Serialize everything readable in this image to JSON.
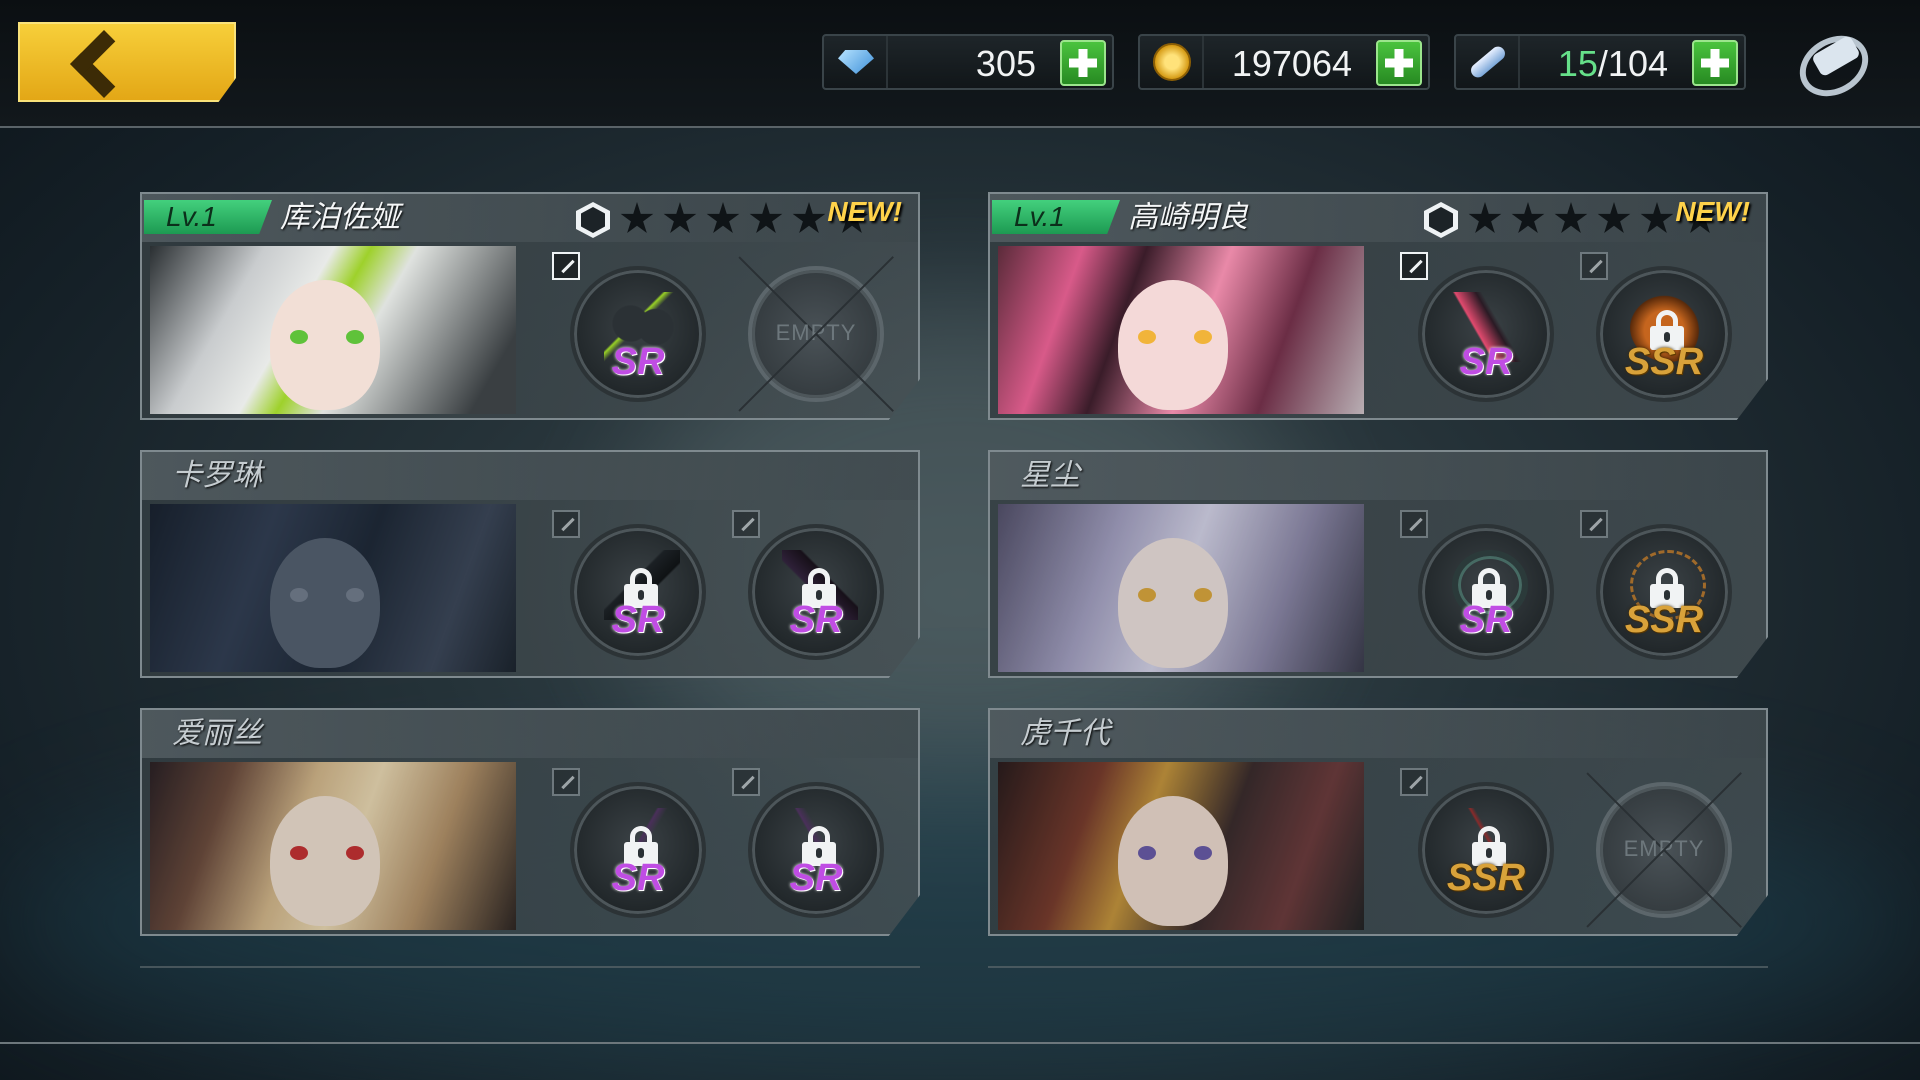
{
  "topbar": {
    "back_label": "",
    "resources": [
      {
        "icon": "diamond-icon",
        "value": "305"
      },
      {
        "icon": "gold-coin-icon",
        "value": "197064"
      },
      {
        "icon": "stamina-icon",
        "current": "15",
        "rest": "/104"
      }
    ],
    "menu_icon": "visor-menu-icon"
  },
  "cards": [
    {
      "level": "Lv.1",
      "name": "库泊佐娅",
      "new": "NEW!",
      "stars_filled": 0,
      "stars_total": 6,
      "slot1": {
        "rarity": "SR",
        "locked": false,
        "empty": false
      },
      "slot2": {
        "label": "EMPTY",
        "empty": true
      }
    },
    {
      "level": "Lv.1",
      "name": "高崎明良",
      "new": "NEW!",
      "stars_filled": 0,
      "stars_total": 6,
      "slot1": {
        "rarity": "SR",
        "locked": false,
        "empty": false
      },
      "slot2": {
        "rarity": "SSR",
        "locked": true,
        "empty": false
      }
    },
    {
      "name": "卡罗琳",
      "slot1": {
        "rarity": "SR",
        "locked": true
      },
      "slot2": {
        "rarity": "SR",
        "locked": true
      }
    },
    {
      "name": "星尘",
      "slot1": {
        "rarity": "SR",
        "locked": true
      },
      "slot2": {
        "rarity": "SSR",
        "locked": true
      }
    },
    {
      "name": "爱丽丝",
      "slot1": {
        "rarity": "SR",
        "locked": true
      },
      "slot2": {
        "rarity": "SR",
        "locked": true
      }
    },
    {
      "name": "虎千代",
      "slot1": {
        "rarity": "SSR",
        "locked": true
      },
      "slot2": {
        "label": "EMPTY",
        "empty": true
      }
    }
  ],
  "colors": {
    "level_badge": "#2bb86a",
    "new_label": "#ffd24a",
    "sr": "#c04de4",
    "ssr": "#d9a23a",
    "plus_button": "#38a82f",
    "back_button": "#f0bd28"
  }
}
